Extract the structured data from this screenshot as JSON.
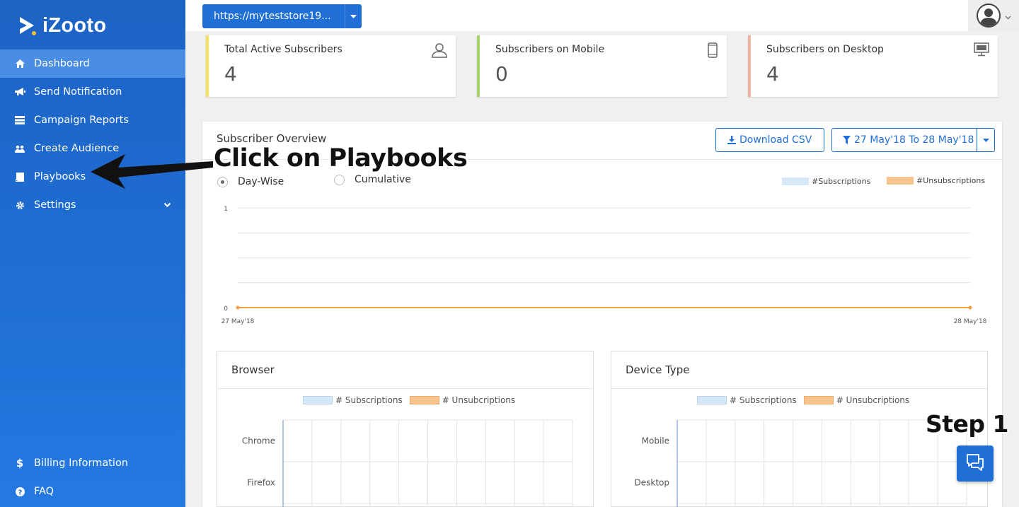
{
  "brand": {
    "logo_text": "iZooto"
  },
  "sidebar": {
    "items": [
      {
        "label": "Dashboard",
        "icon": "home-icon",
        "active": true
      },
      {
        "label": "Send Notification",
        "icon": "megaphone-icon"
      },
      {
        "label": "Campaign Reports",
        "icon": "list-icon"
      },
      {
        "label": "Create Audience",
        "icon": "users-icon"
      },
      {
        "label": "Playbooks",
        "icon": "book-icon"
      },
      {
        "label": "Settings",
        "icon": "gear-icon",
        "has_submenu": true
      }
    ],
    "bottom_items": [
      {
        "label": "Billing Information",
        "icon": "dollar-icon"
      },
      {
        "label": "FAQ",
        "icon": "question-icon"
      }
    ]
  },
  "topbar": {
    "site_url": "https://myteststore19..."
  },
  "stats": [
    {
      "label": "Total Active Subscribers",
      "value": "4",
      "icon": "user-icon",
      "accent": "#f5e15a"
    },
    {
      "label": "Subscribers on Mobile",
      "value": "0",
      "icon": "mobile-icon",
      "accent": "#a6d36a"
    },
    {
      "label": "Subscribers on Desktop",
      "value": "4",
      "icon": "desktop-icon",
      "accent": "#f2b3a3"
    }
  ],
  "overview": {
    "title": "Subscriber Overview",
    "download_label": "Download CSV",
    "date_range_label": "27 May'18 To 28 May'18",
    "mode_daywise": "Day-Wise",
    "mode_cumulative": "Cumulative",
    "selected_mode": "Day-Wise",
    "legend_subscriptions": "#Subscriptions",
    "legend_unsubscriptions": "#Unsubscriptions"
  },
  "chart_data": [
    {
      "type": "line",
      "x": [
        "27 May'18",
        "28 May'18"
      ],
      "series": [
        {
          "name": "#Subscriptions",
          "values": [
            0,
            0
          ],
          "color": "#d6e8f8"
        },
        {
          "name": "#Unsubscriptions",
          "values": [
            0,
            0
          ],
          "color": "#f5a040"
        }
      ],
      "yticks": [
        "0",
        "1"
      ],
      "ylim": [
        0,
        1
      ],
      "grid": true
    },
    {
      "type": "bar",
      "title": "Browser",
      "categories": [
        "Chrome",
        "Firefox"
      ],
      "series": [
        {
          "name": "# Subscriptions",
          "color": "#d6e8f8"
        },
        {
          "name": "# Unsubcriptions",
          "color": "#f7c48e"
        }
      ]
    },
    {
      "type": "bar",
      "title": "Device Type",
      "categories": [
        "Mobile",
        "Desktop"
      ],
      "series": [
        {
          "name": "# Subscriptions",
          "color": "#d6e8f8"
        },
        {
          "name": "# Unsubcriptions",
          "color": "#f7c48e"
        }
      ]
    }
  ],
  "annotations": {
    "callout": "Click on Playbooks",
    "step": "Step 1"
  },
  "colors": {
    "primary": "#1f6fd6",
    "orange": "#f5a040"
  }
}
